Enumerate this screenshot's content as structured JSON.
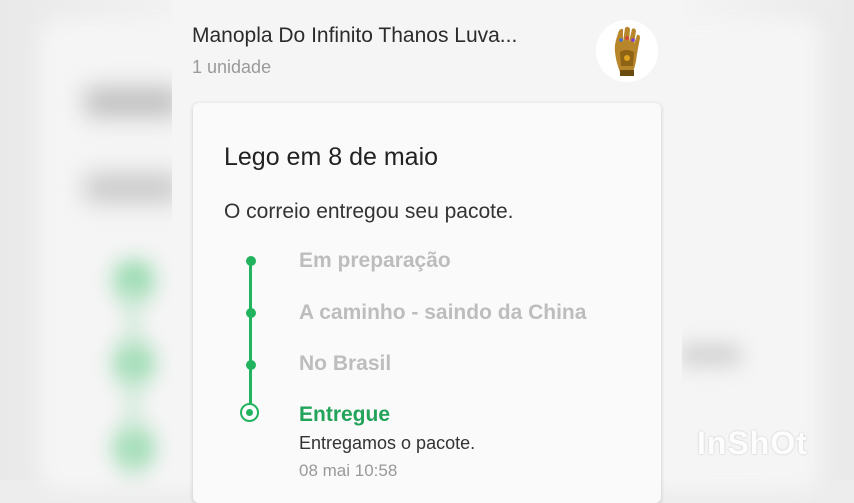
{
  "product": {
    "title": "Manopla Do Infinito Thanos Luva...",
    "quantity": "1 unidade",
    "thumbnail_icon": "gauntlet-image"
  },
  "delivery": {
    "title": "Lego em 8 de maio",
    "status_text": "O correio entregou seu pacote.",
    "steps": [
      {
        "label": "Em preparação",
        "state": "done"
      },
      {
        "label": "A caminho - saindo da China",
        "state": "done"
      },
      {
        "label": "No Brasil",
        "state": "done"
      },
      {
        "label": "Entregue",
        "state": "current",
        "description": "Entregamos o pacote.",
        "timestamp": "08 mai 10:58"
      }
    ]
  },
  "colors": {
    "accent_green": "#22b35e",
    "inactive_step": "#bdbdbd"
  },
  "watermark": "InShOt"
}
